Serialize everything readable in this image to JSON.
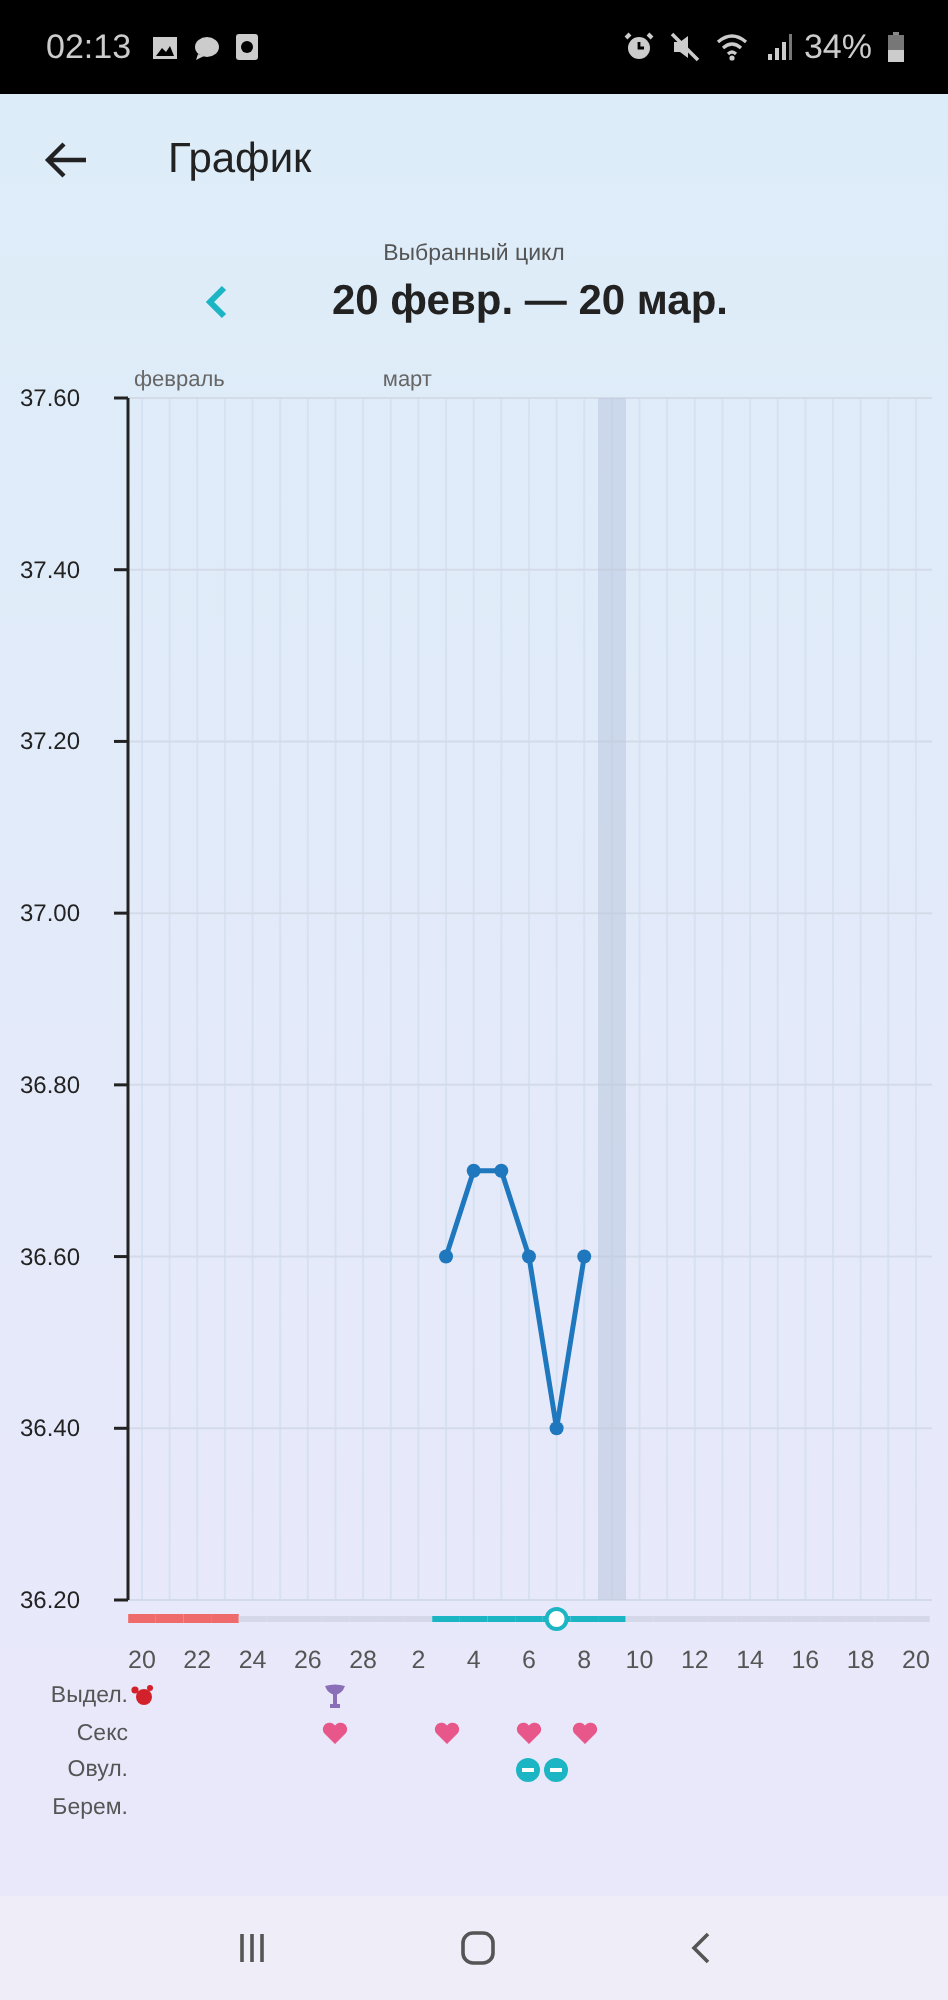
{
  "status_bar": {
    "time": "02:13",
    "battery": "34%"
  },
  "header": {
    "title": "График"
  },
  "cycle": {
    "caption": "Выбранный цикл",
    "range": "20 февр. — 20 мар."
  },
  "chart": {
    "chart_data": {
      "type": "line",
      "ylim": [
        36.2,
        37.6
      ],
      "grid": true,
      "marker": true,
      "categories": [
        "20",
        null,
        "22",
        null,
        "24",
        null,
        "26",
        null,
        "28",
        null,
        "2",
        null,
        "4",
        null,
        "6",
        null,
        "8",
        null,
        "10",
        null,
        "12",
        null,
        "14",
        null,
        "16",
        null,
        "18",
        null,
        "20"
      ],
      "values": [
        null,
        null,
        null,
        null,
        null,
        null,
        null,
        null,
        null,
        null,
        null,
        36.6,
        36.7,
        36.7,
        36.6,
        36.4,
        36.6,
        null,
        null,
        null,
        null,
        null,
        null,
        null,
        null,
        null,
        null,
        null,
        null
      ],
      "yticks": [
        {
          "value": 36.2,
          "label": "36.20"
        },
        {
          "value": 36.4,
          "label": "36.40"
        },
        {
          "value": 36.6,
          "label": "36.60"
        },
        {
          "value": 36.8,
          "label": "36.80"
        },
        {
          "value": 37.0,
          "label": "37.00"
        },
        {
          "value": 37.2,
          "label": "37.20"
        },
        {
          "value": 37.4,
          "label": "37.40"
        },
        {
          "value": 37.6,
          "label": "37.60"
        }
      ]
    },
    "days": [
      {
        "month": "февраль",
        "kind": "period"
      },
      {
        "kind": "period"
      },
      {
        "kind": "period"
      },
      {
        "kind": "period"
      },
      {
        "kind": "normal"
      },
      {
        "kind": "normal"
      },
      {
        "kind": "normal"
      },
      {
        "kind": "normal"
      },
      {
        "kind": "normal"
      },
      {
        "month": "март",
        "kind": "normal"
      },
      {
        "kind": "normal"
      },
      {
        "kind": "fertile"
      },
      {
        "kind": "fertile"
      },
      {
        "kind": "fertile"
      },
      {
        "kind": "fertile"
      },
      {
        "kind": "ovulation"
      },
      {
        "kind": "fertile"
      },
      {
        "kind": "fertile",
        "selected": true
      },
      {
        "kind": "normal"
      },
      {
        "kind": "normal"
      },
      {
        "kind": "normal"
      },
      {
        "kind": "normal"
      },
      {
        "kind": "normal"
      },
      {
        "kind": "normal"
      },
      {
        "kind": "normal"
      },
      {
        "kind": "normal"
      },
      {
        "kind": "normal"
      },
      {
        "kind": "normal"
      },
      {
        "kind": "normal"
      }
    ]
  },
  "marker_rows": [
    {
      "label": "Выдел.",
      "cells": [
        {
          "kind": "blood"
        },
        null,
        null,
        null,
        null,
        null,
        null,
        {
          "kind": "spotting"
        }
      ]
    },
    {
      "label": "Секс",
      "cells": [
        null,
        null,
        null,
        null,
        null,
        null,
        null,
        {
          "kind": "heart"
        },
        null,
        null,
        null,
        {
          "kind": "heart"
        },
        null,
        null,
        {
          "kind": "heart"
        },
        null,
        {
          "kind": "heart"
        }
      ]
    },
    {
      "label": "Овул.",
      "cells": [
        null,
        null,
        null,
        null,
        null,
        null,
        null,
        null,
        null,
        null,
        null,
        null,
        null,
        null,
        {
          "kind": "ovulation"
        },
        {
          "kind": "ovulation"
        }
      ]
    },
    {
      "label": "Берем."
    }
  ]
}
